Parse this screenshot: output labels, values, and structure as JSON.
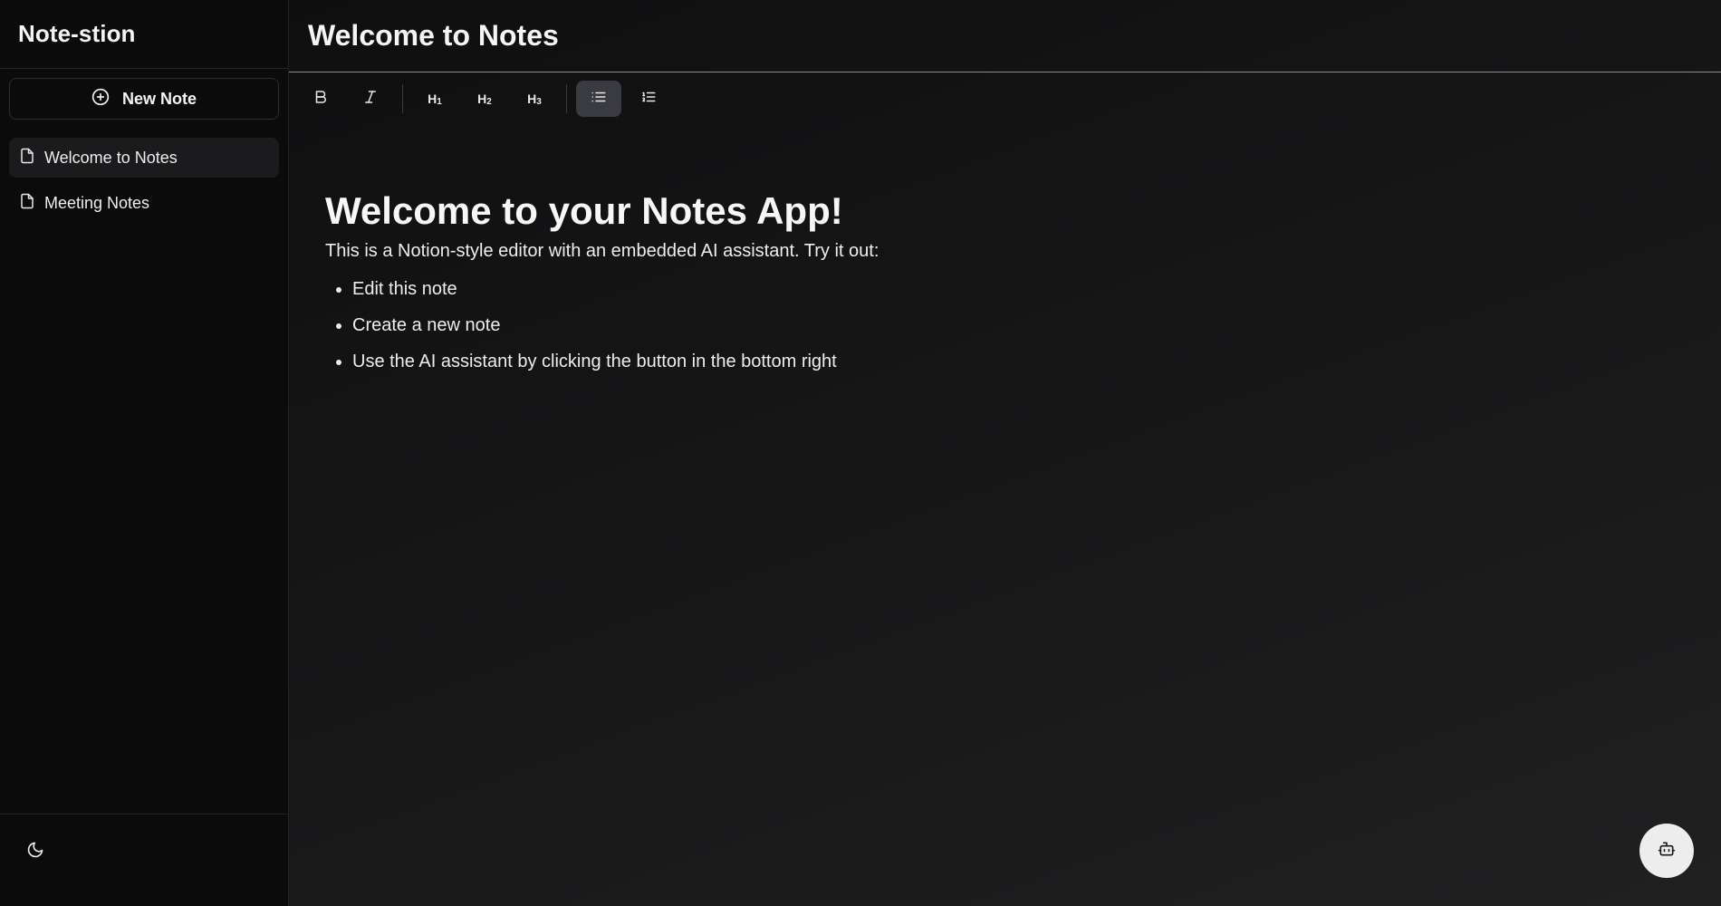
{
  "sidebar": {
    "app_title": "Note-stion",
    "new_note_label": "New Note",
    "notes": [
      {
        "label": "Welcome to Notes",
        "active": true
      },
      {
        "label": "Meeting Notes",
        "active": false
      }
    ]
  },
  "header": {
    "title": "Welcome to Notes"
  },
  "toolbar": {
    "h1_label": "H",
    "h1_sub": "1",
    "h2_label": "H",
    "h2_sub": "2",
    "h3_label": "H",
    "h3_sub": "3"
  },
  "editor": {
    "heading": "Welcome to your Notes App!",
    "paragraph": "This is a Notion-style editor with an embedded AI assistant. Try it out:",
    "bullets": [
      "Edit this note",
      "Create a new note",
      "Use the AI assistant by clicking the button in the bottom right"
    ]
  },
  "icons": {
    "new_note": "plus-circle-icon",
    "note": "file-icon",
    "theme": "moon-icon",
    "ai": "bot-icon"
  },
  "colors": {
    "background": "#0b0b0c",
    "active_item": "#1b1b1d",
    "active_tool": "#3a3b40",
    "ai_button": "#ededed"
  }
}
